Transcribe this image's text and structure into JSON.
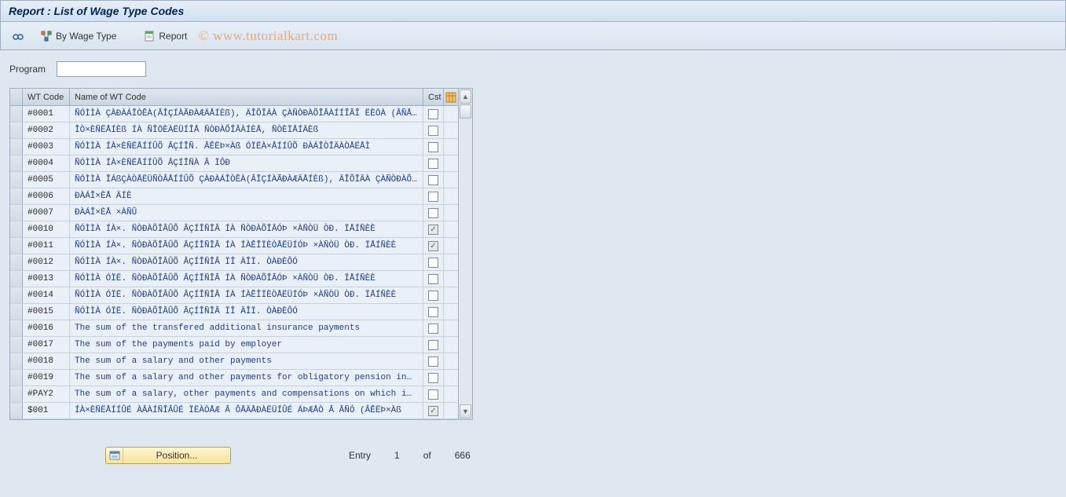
{
  "title": "Report : List of Wage Type Codes",
  "toolbar": {
    "detail_icon_label": "Detail",
    "by_wage_type_label": "By Wage Type",
    "report_label": "Report"
  },
  "watermark": "© www.tutorialkart.com",
  "program": {
    "label": "Program",
    "value": ""
  },
  "chart_data": {
    "type": "table",
    "columns": [
      "WT Code",
      "Name of WT Code",
      "Cst"
    ],
    "rows": [
      {
        "code": "#0001",
        "name": "ÑÓÌÌÀ ÇÀÐÀÁÎÒÊÀ(ÂÎÇÍÀÃÐÀÆÄÅÍÈß), ÄÎÕÎÄÀ ÇÀÑÒÐÀÕÎÂÀÍÍÎÃÎ ËÈÖÀ (ÂÑÅ…",
        "cst": false
      },
      {
        "code": "#0002",
        "name": "ÎÒ×ÈÑËÅÍÈß ÍÀ ÑÎÖÈÀËÜÍÎÅ ÑÒÐÀÕÎÂÀÍÈÅ, ÑÒÈÏÅÍÄÈß",
        "cst": false
      },
      {
        "code": "#0003",
        "name": "ÑÓÌÌÀ ÍÀ×ÈÑËÅÍÍÛÕ ÂÇÍÎÑ. ÂÊËÞ×Àß ÓÏËÀ×ÅÍÍÛÕ ÐÀÁÎÒÎÄÀÒÅËÅÌ",
        "cst": false
      },
      {
        "code": "#0004",
        "name": "ÑÓÌÌÀ ÍÀ×ÈÑËÅÍÍÛÕ ÂÇÍÎÑÀ Â ÏÔÐ",
        "cst": false
      },
      {
        "code": "#0005",
        "name": "ÑÓÌÌÀ ÎÁßÇÀÒÅËÜÑÒÂÅÍÍÛÕ ÇÀÐÀÁÎÒÊÀ(ÂÎÇÍÀÃÐÀÆÄÅÍÈß), ÄÎÕÎÄÀ ÇÀÑÒÐÀÕ…",
        "cst": false
      },
      {
        "code": "#0006",
        "name": "ÐÀÁÎ×ÈÅ ÄÍÈ",
        "cst": false
      },
      {
        "code": "#0007",
        "name": "ÐÀÁÎ×ÈÅ ×ÀÑÛ",
        "cst": false
      },
      {
        "code": "#0010",
        "name": "ÑÓÌÌÀ ÍÀ×. ÑÒÐÀÕÎÂÛÕ ÂÇÍÎÑÎÂ ÍÀ ÑÒÐÀÕÎÂÓÞ ×ÀÑÒÜ ÒÐ. ÏÅÍÑÈÈ",
        "cst": true
      },
      {
        "code": "#0011",
        "name": "ÑÓÌÌÀ ÍÀ×. ÑÒÐÀÕÎÂÛÕ ÂÇÍÎÑÎÂ ÍÀ ÍÀÊÎÏÈÒÅËÜÍÓÞ ×ÀÑÒÜ ÒÐ. ÏÅÍÑÈÈ",
        "cst": true
      },
      {
        "code": "#0012",
        "name": "ÑÓÌÌÀ ÍÀ×. ÑÒÐÀÕÎÂÛÕ ÂÇÍÎÑÎÂ ÏÎ ÄÎÏ. ÒÀÐÈÔÓ",
        "cst": false
      },
      {
        "code": "#0013",
        "name": "ÑÓÌÌÀ ÓÏË. ÑÒÐÀÕÎÂÛÕ ÂÇÍÎÑÎÂ ÍÀ ÑÒÐÀÕÎÂÓÞ ×ÀÑÒÜ ÒÐ. ÏÅÍÑÈÈ",
        "cst": false
      },
      {
        "code": "#0014",
        "name": "ÑÓÌÌÀ ÓÏË. ÑÒÐÀÕÎÂÛÕ ÂÇÍÎÑÎÂ ÍÀ ÍÀÊÎÏÈÒÅËÜÍÓÞ ×ÀÑÒÜ ÒÐ. ÏÅÍÑÈÈ",
        "cst": false
      },
      {
        "code": "#0015",
        "name": "ÑÓÌÌÀ ÓÏË. ÑÒÐÀÕÎÂÛÕ ÂÇÍÎÑÎÂ ÏÎ ÄÎÏ. ÒÀÐÈÔÓ",
        "cst": false
      },
      {
        "code": "#0016",
        "name": "The sum of the transfered additional insurance payments",
        "cst": false
      },
      {
        "code": "#0017",
        "name": "The sum of the payments paid by employer",
        "cst": false
      },
      {
        "code": "#0018",
        "name": "The sum of a salary and other payments",
        "cst": false
      },
      {
        "code": "#0019",
        "name": "The sum of a salary and other payments for obligatory pension in…",
        "cst": false
      },
      {
        "code": "#PAY2",
        "name": "The sum of a salary, other payments and compensations on which i…",
        "cst": false
      },
      {
        "code": "$001",
        "name": "ÍÀ×ÈÑËÅÍÍÛÉ ÀÂÀÍÑÎÂÛÉ ÏËÀÒÅÆ Â ÔÅÄÅÐÀËÜÍÛÉ ÁÞÆÅÒ Â ÂÑÓ (ÂÊËÞ×Àß",
        "cst": true
      }
    ]
  },
  "table": {
    "headers": {
      "select": "",
      "code": "WT Code",
      "name": "Name of WT Code",
      "cst": "Cst",
      "config": ""
    }
  },
  "footer": {
    "position_label": "Position...",
    "entry_label": "Entry",
    "current": "1",
    "of_label": "of",
    "total": "666"
  }
}
